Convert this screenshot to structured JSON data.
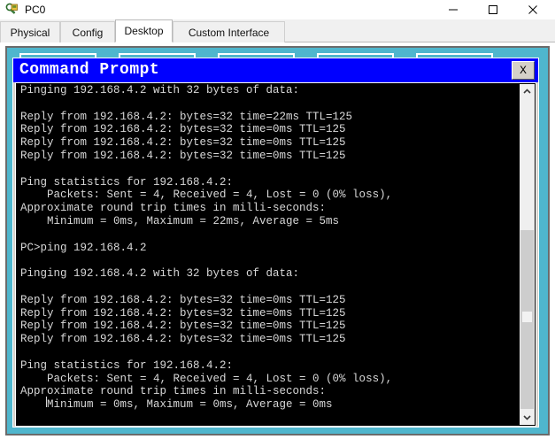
{
  "window": {
    "title": "PC0",
    "app_icon": "device-pc-icon",
    "controls": {
      "minimize_label": "—",
      "maximize_label": "□",
      "close_label": "✕"
    }
  },
  "tabs": [
    {
      "label": "Physical",
      "active": false
    },
    {
      "label": "Config",
      "active": false
    },
    {
      "label": "Desktop",
      "active": true
    },
    {
      "label": "Custom Interface",
      "active": false
    }
  ],
  "desktop": {
    "background_color": "#4fb6cd",
    "icons": [
      {
        "name": "desktop-icon-1"
      },
      {
        "name": "desktop-icon-2"
      },
      {
        "name": "desktop-icon-3"
      },
      {
        "name": "desktop-icon-4"
      },
      {
        "name": "desktop-icon-5"
      }
    ]
  },
  "command_prompt": {
    "title": "Command Prompt",
    "title_bar_color": "#0000ff",
    "close_button_label": "X",
    "terminal_background": "#000000",
    "terminal_foreground": "#d8d8d8",
    "prompt_symbol": "PC>",
    "output": "Pinging 192.168.4.2 with 32 bytes of data:\n\nReply from 192.168.4.2: bytes=32 time=22ms TTL=125\nReply from 192.168.4.2: bytes=32 time=0ms TTL=125\nReply from 192.168.4.2: bytes=32 time=0ms TTL=125\nReply from 192.168.4.2: bytes=32 time=0ms TTL=125\n\nPing statistics for 192.168.4.2:\n    Packets: Sent = 4, Received = 4, Lost = 0 (0% loss),\nApproximate round trip times in milli-seconds:\n    Minimum = 0ms, Maximum = 22ms, Average = 5ms\n\nPC>ping 192.168.4.2\n\nPinging 192.168.4.2 with 32 bytes of data:\n\nReply from 192.168.4.2: bytes=32 time=0ms TTL=125\nReply from 192.168.4.2: bytes=32 time=0ms TTL=125\nReply from 192.168.4.2: bytes=32 time=0ms TTL=125\nReply from 192.168.4.2: bytes=32 time=0ms TTL=125\n\nPing statistics for 192.168.4.2:\n    Packets: Sent = 4, Received = 4, Lost = 0 (0% loss),\nApproximate round trip times in milli-seconds:\n    Minimum = 0ms, Maximum = 0ms, Average = 0ms\n\nPC>",
    "scrollbar": {
      "up_arrow_label": "▲",
      "down_arrow_label": "▼"
    }
  }
}
